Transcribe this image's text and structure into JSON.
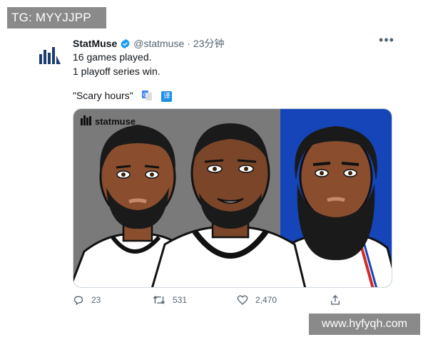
{
  "overlay": {
    "top_left_tag": "TG: MYYJJPP",
    "bottom_right_tag": "www.hyfyqh.com"
  },
  "tweet": {
    "author_name": "StatMuse",
    "handle": "@statmuse",
    "separator": "·",
    "time": "23分钟",
    "lines": [
      "16 games played.",
      "1 playoff series win.",
      "\"Scary hours\""
    ],
    "translate_label": "译",
    "media": {
      "logo_text": "statmuse",
      "panel_colors": {
        "left": "#7a7a7a",
        "mid": "#7a7a7a",
        "right": "#1545b8"
      }
    },
    "actions": {
      "replies": "23",
      "retweets": "531",
      "likes": "2,470"
    },
    "icons": {
      "avatar": "statmuse-logo-icon",
      "verified": "verified-badge-icon",
      "more": "more-icon",
      "reply": "reply-icon",
      "retweet": "retweet-icon",
      "like": "heart-icon",
      "share": "share-icon",
      "translate": "google-translate-icon"
    },
    "colors": {
      "accent": "#1d9bf0",
      "muted": "#536471",
      "logo": "#1b3d6e"
    }
  }
}
